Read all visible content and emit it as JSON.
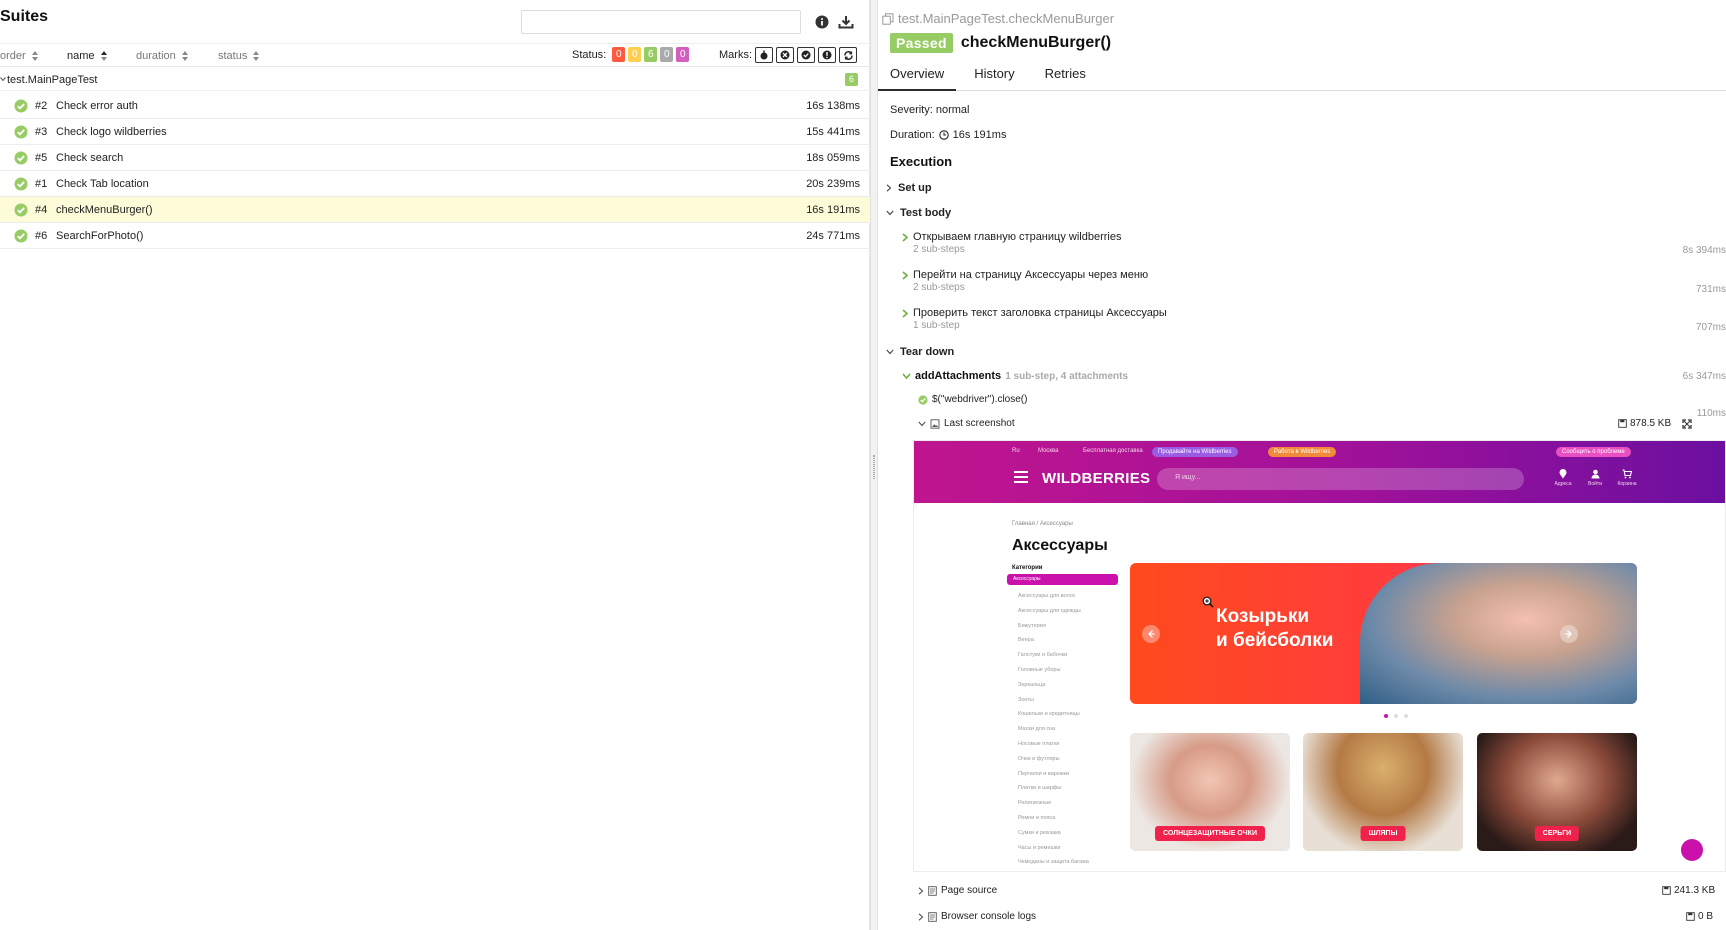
{
  "left": {
    "title": "Suites",
    "sort": {
      "order": "order",
      "name": "name",
      "duration": "duration",
      "status": "status"
    },
    "status_filter": {
      "label": "Status:",
      "counts": [
        {
          "value": "0",
          "color": "#fd5a3e"
        },
        {
          "value": "0",
          "color": "#ffd050"
        },
        {
          "value": "6",
          "color": "#97cc64"
        },
        {
          "value": "0",
          "color": "#aaaaaa"
        },
        {
          "value": "0",
          "color": "#d35ebe"
        }
      ]
    },
    "marks_label": "Marks:",
    "suite": {
      "name": "test.MainPageTest",
      "count": "6"
    },
    "tests": [
      {
        "num": "#2",
        "name": "Check error auth",
        "duration": "16s 138ms"
      },
      {
        "num": "#3",
        "name": "Check logo wildberries",
        "duration": "15s 441ms"
      },
      {
        "num": "#5",
        "name": "Check search",
        "duration": "18s 059ms"
      },
      {
        "num": "#1",
        "name": "Check Tab location",
        "duration": "20s 239ms"
      },
      {
        "num": "#4",
        "name": "checkMenuBurger()",
        "duration": "16s 191ms"
      },
      {
        "num": "#6",
        "name": "SearchForPhoto()",
        "duration": "24s 771ms"
      }
    ]
  },
  "right": {
    "breadcrumb": "test.MainPageTest.checkMenuBurger",
    "status": "Passed",
    "title": "checkMenuBurger()",
    "tabs": [
      "Overview",
      "History",
      "Retries"
    ],
    "severity": "Severity: normal",
    "duration_label": "Duration:",
    "duration": "16s 191ms",
    "execution": "Execution",
    "setup": "Set up",
    "test_body": "Test body",
    "steps": [
      {
        "name": "Открываем главную страницу wildberries",
        "sub": "2 sub-steps",
        "time": "8s 394ms"
      },
      {
        "name": "Перейти на страницу Аксессуары через меню",
        "sub": "2 sub-steps",
        "time": "731ms"
      },
      {
        "name": "Проверить текст заголовка страницы Аксессуары",
        "sub": "1 sub-step",
        "time": "707ms"
      }
    ],
    "teardown": "Tear down",
    "attach": {
      "name": "addAttachments",
      "meta": "1 sub-step, 4 attachments",
      "time": "6s 347ms",
      "substep": "$(\"webdriver\").close()",
      "substep_time": "110ms",
      "last_screenshot": "Last screenshot",
      "last_screenshot_size": "878.5 KB",
      "page_source": "Page source",
      "page_source_size": "241.3 KB",
      "console_logs": "Browser console logs",
      "console_logs_size": "0 B"
    }
  },
  "screenshot": {
    "top_links": [
      "Ru",
      "Москва",
      "Бесплатная доставка"
    ],
    "pill_1": "Продавайте на Wildberries",
    "pill_2": "Работа в Wildberries",
    "pill_3": "Сообщить о проблеме",
    "logo": "WILDBERRIES",
    "search": "Я ищу...",
    "nav": [
      "Адреса",
      "Войти",
      "Корзина"
    ],
    "breadcrumb": "Главная  /  Аксессуары",
    "heading": "Аксессуары",
    "categories_title": "Категории",
    "categories_active": "Аксессуары",
    "categories": [
      "Аксессуары для волос",
      "Аксессуары для одежды",
      "Бижутерия",
      "Веера",
      "Галстуки и бабочки",
      "Головные уборы",
      "Зеркальца",
      "Зонты",
      "Кошельки и кредитницы",
      "Маски для сна",
      "Носовые платки",
      "Очки и футляры",
      "Перчатки и варежки",
      "Платки и шарфы",
      "Религиозные",
      "Ремни и пояса",
      "Сумки и рюкзаки",
      "Часы и ремешки",
      "Чемоданы и защита багажа"
    ],
    "banner_line1": "Козырьки",
    "banner_line2": "и бейсболки",
    "cards": [
      "СОЛНЦЕЗАЩИТНЫЕ ОЧКИ",
      "ШЛЯПЫ",
      "СЕРЬГИ"
    ]
  }
}
